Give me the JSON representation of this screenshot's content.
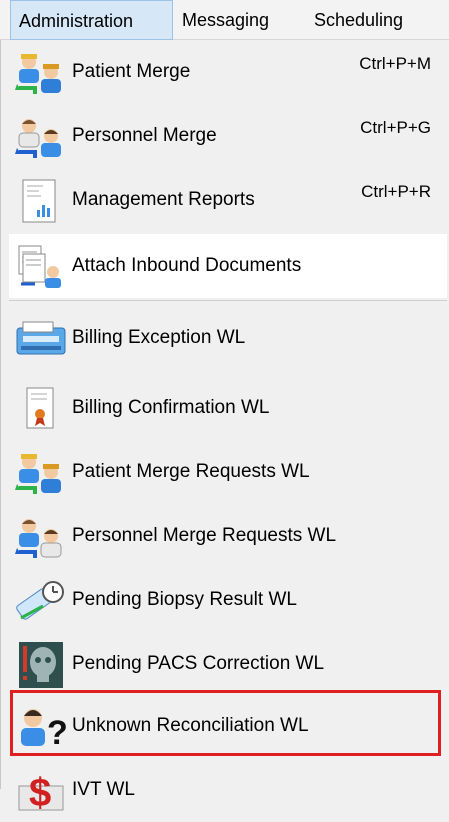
{
  "menubar": {
    "items": [
      {
        "label": "Administration"
      },
      {
        "label": "Messaging"
      },
      {
        "label": "Scheduling"
      }
    ]
  },
  "menu": {
    "items": [
      {
        "label": "Patient Merge",
        "shortcut": "Ctrl+P+M",
        "icon": "patient-merge-icon"
      },
      {
        "label": "Personnel Merge",
        "shortcut": "Ctrl+P+G",
        "icon": "personnel-merge-icon"
      },
      {
        "label": "Management Reports",
        "shortcut": "Ctrl+P+R",
        "icon": "report-chart-icon"
      },
      {
        "label": "Attach Inbound Documents",
        "icon": "attach-documents-icon"
      },
      {
        "label": "Billing Exception WL",
        "icon": "billing-machine-icon"
      },
      {
        "label": "Billing Confirmation WL",
        "icon": "certificate-document-icon"
      },
      {
        "label": "Patient Merge Requests WL",
        "icon": "patient-merge-icon"
      },
      {
        "label": "Personnel Merge Requests WL",
        "icon": "personnel-merge-icon"
      },
      {
        "label": "Pending Biopsy Result WL",
        "icon": "biopsy-clock-icon"
      },
      {
        "label": "Pending PACS Correction WL",
        "icon": "xray-skull-icon"
      },
      {
        "label": "Unknown Reconciliation WL",
        "icon": "unknown-person-icon"
      },
      {
        "label": "IVT WL",
        "icon": "dollar-icon"
      }
    ]
  },
  "colors": {
    "highlight": "#e02020",
    "hover_bg": "#ffffff",
    "menu_bg": "#f0f0f0"
  }
}
